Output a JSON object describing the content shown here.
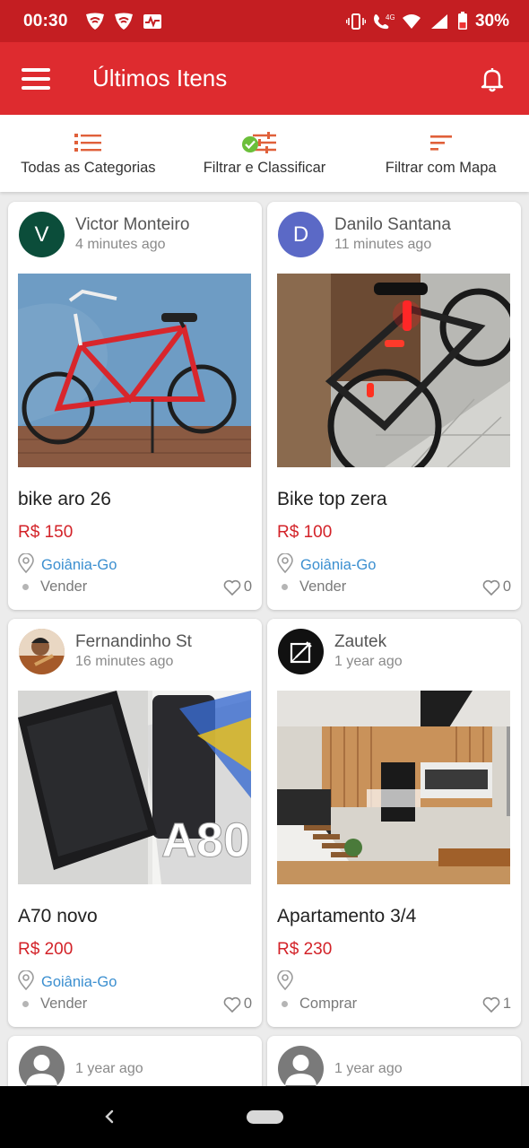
{
  "status_bar": {
    "time": "00:30",
    "battery": "30%"
  },
  "app_bar": {
    "title": "Últimos Itens"
  },
  "toolbar": {
    "categories": "Todas as Categorias",
    "filter_sort": "Filtrar e Classificar",
    "map_filter": "Filtrar com Mapa"
  },
  "colors": {
    "primary": "#de2b2f",
    "status": "#c41e22",
    "price": "#d32228",
    "link": "#3b8fd0"
  },
  "listings": [
    {
      "initial": "V",
      "avatar_color": "#0b4d3a",
      "seller": "Victor Monteiro",
      "ago": "4 minutes ago",
      "title": "bike aro 26",
      "price": "R$ 150",
      "location": "Goiânia-Go",
      "type": "Vender",
      "likes": "0"
    },
    {
      "initial": "D",
      "avatar_color": "#5b69c6",
      "seller": "Danilo Santana",
      "ago": "11 minutes ago",
      "title": "Bike top zera",
      "price": "R$ 100",
      "location": "Goiânia-Go",
      "type": "Vender",
      "likes": "0"
    },
    {
      "initial": "",
      "avatar_color": "#c98a5a",
      "seller": "Fernandinho St",
      "ago": "16 minutes ago",
      "title": "A70 novo",
      "price": "R$ 200",
      "location": "Goiânia-Go",
      "type": "Vender",
      "likes": "0"
    },
    {
      "initial": "",
      "avatar_color": "#111111",
      "seller": "Zautek",
      "ago": "1 year ago",
      "title": "Apartamento 3/4",
      "price": "R$ 230",
      "location": "",
      "type": "Comprar",
      "likes": "1"
    },
    {
      "initial": "",
      "avatar_color": "#7a7a7a",
      "seller": "",
      "ago": "1 year ago"
    },
    {
      "initial": "",
      "avatar_color": "#7a7a7a",
      "seller": "",
      "ago": "1 year ago"
    }
  ]
}
